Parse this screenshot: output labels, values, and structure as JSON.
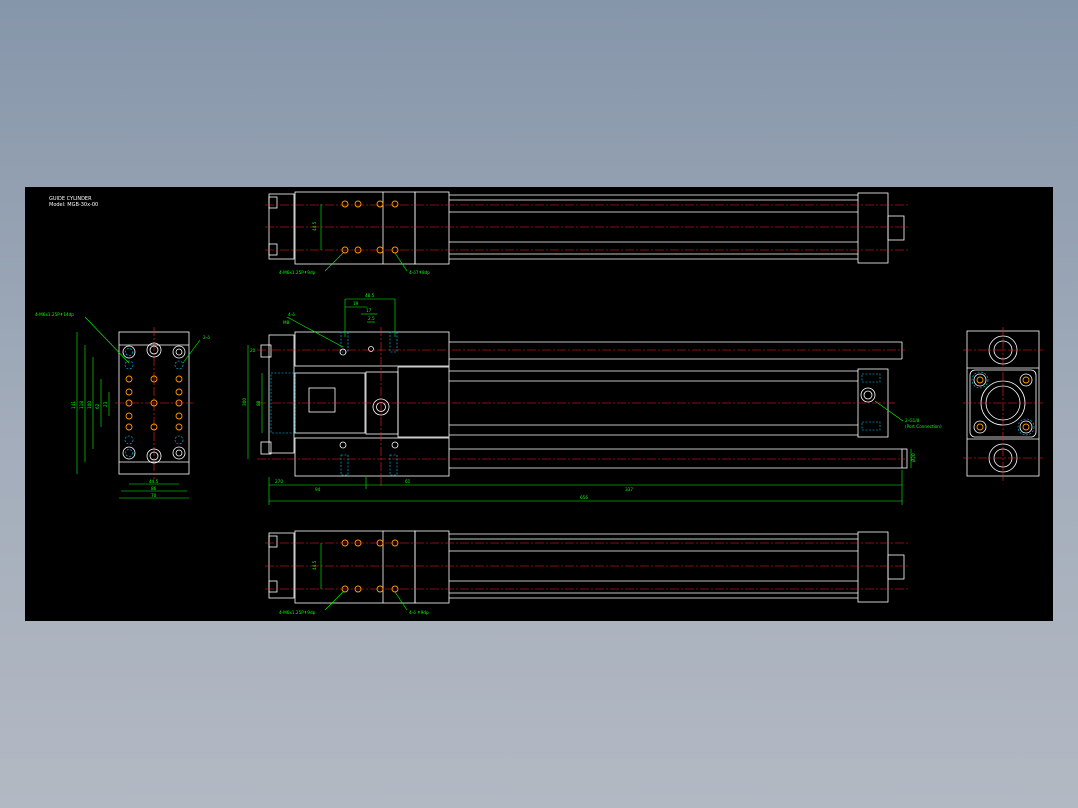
{
  "title_block": {
    "line1": "GUIDE CYLINDER",
    "line2": "Model: MGB-30x-00"
  },
  "notes": {
    "top_left_holes": "4-M6x1.25P↟9dp",
    "top_right_holes": "4-ö7↟8dp",
    "left_top_callout": "4-M6x1.25P↟14dp",
    "left_side_callout": "2-ö",
    "front_callout": "4-ö",
    "port_callout": "2-G1/8",
    "port_callout2": "(Port Connection)",
    "bottom_left_holes": "4-M6x1.25P↟9dp",
    "bottom_right_holes": "4-ö ↟9dp"
  },
  "dimensions": {
    "top_vertical": "44.5",
    "bottom_vertical": "44.5",
    "side_width_inner": "44.5",
    "side_width_mid": "86",
    "side_width_outer": "70",
    "side_h1": "141",
    "side_h2": "118",
    "side_h3": "100",
    "side_h4": "62",
    "side_h5": "23",
    "front_width_top": "48.5",
    "front_w2": "19",
    "front_w3": "17",
    "front_w4": "2.5",
    "front_left_h": "300",
    "front_inner_h": "88",
    "front_small": "20",
    "front_bottom1": "270",
    "front_bottom2": "94",
    "front_bottom3": "61",
    "front_bottom4": "337",
    "front_total": "656",
    "front_right_dim": "Ø20",
    "front_top_left": "M8"
  }
}
